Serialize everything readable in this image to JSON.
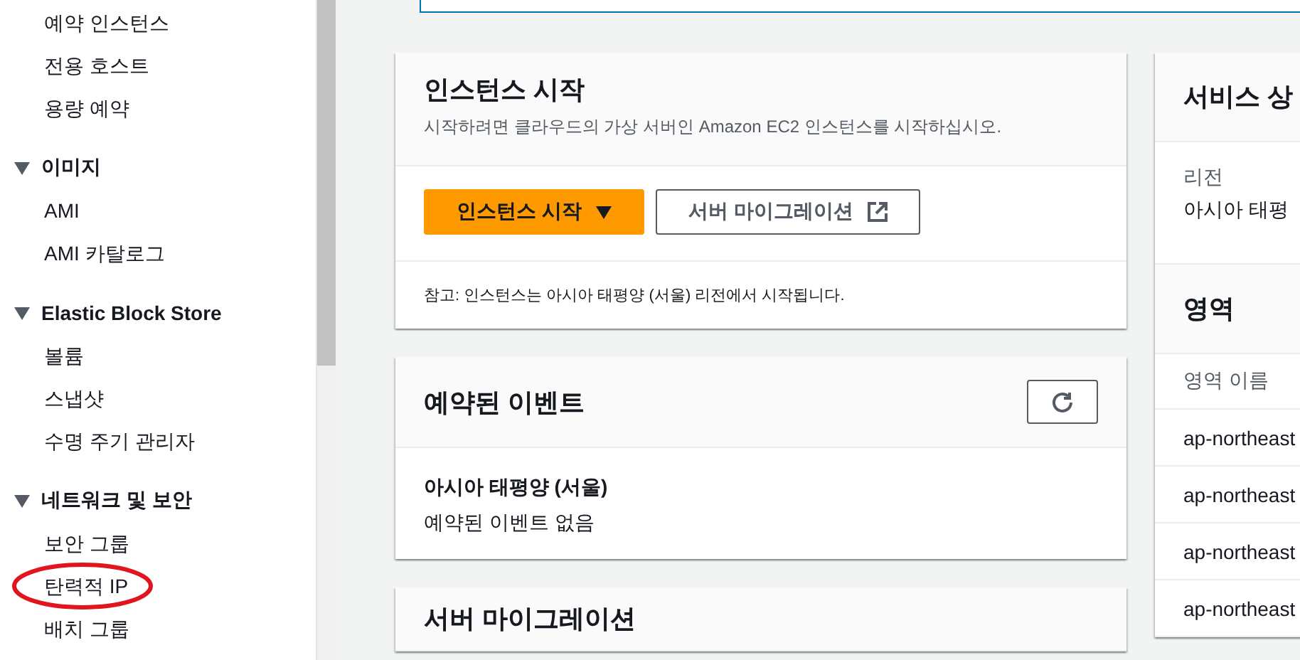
{
  "sidebar": {
    "sections": [
      {
        "items": [
          {
            "label": "예약 인스턴스",
            "circled": false
          },
          {
            "label": "전용 호스트",
            "circled": false
          },
          {
            "label": "용량 예약",
            "circled": false
          }
        ]
      },
      {
        "title": "이미지",
        "expanded": true,
        "items": [
          {
            "label": "AMI",
            "circled": false
          },
          {
            "label": "AMI 카탈로그",
            "circled": false
          }
        ]
      },
      {
        "title": "Elastic Block Store",
        "expanded": true,
        "items": [
          {
            "label": "볼륨",
            "circled": false
          },
          {
            "label": "스냅샷",
            "circled": false
          },
          {
            "label": "수명 주기 관리자",
            "circled": false
          }
        ]
      },
      {
        "title": "네트워크 및 보안",
        "expanded": true,
        "items": [
          {
            "label": "보안 그룹",
            "circled": false
          },
          {
            "label": "탄력적 IP",
            "circled": true
          },
          {
            "label": "배치 그룹",
            "circled": false
          }
        ]
      }
    ]
  },
  "launch_card": {
    "title": "인스턴스 시작",
    "description": "시작하려면 클라우드의 가상 서버인 Amazon EC2 인스턴스를 시작하십시오.",
    "buttons": [
      {
        "label": "인스턴스 시작",
        "kind": "primary"
      },
      {
        "label": "서버 마이그레이션",
        "kind": "external"
      }
    ],
    "note": "참고: 인스턴스는 아시아 태평양 (서울) 리전에서 시작됩니다."
  },
  "events_card": {
    "title": "예약된 이벤트",
    "region": "아시아 태평양 (서울)",
    "message": "예약된 이벤트 없음"
  },
  "migration_card": {
    "title": "서버 마이그레이션"
  },
  "service_health": {
    "title": "서비스 상",
    "region_label": "리전",
    "region_value": "아시아 태평"
  },
  "zones": {
    "title": "영역",
    "column": "영역 이름",
    "rows": [
      "ap-northeast",
      "ap-northeast",
      "ap-northeast",
      "ap-northeast"
    ]
  }
}
